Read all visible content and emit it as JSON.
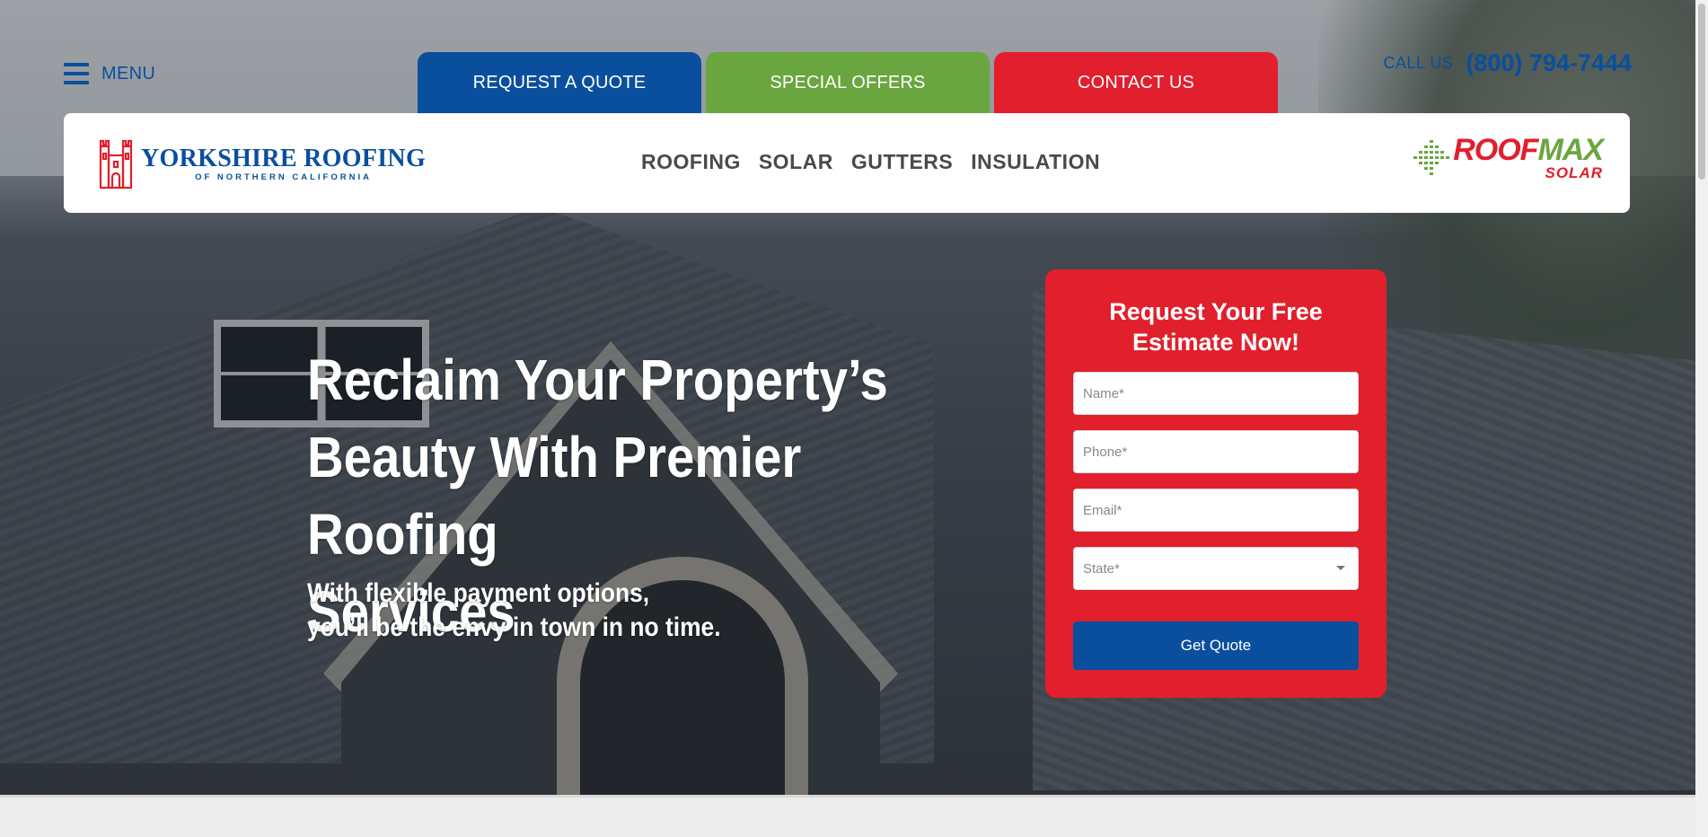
{
  "topbar": {
    "menu_label": "MENU",
    "tabs": [
      {
        "label": "REQUEST A QUOTE"
      },
      {
        "label": "SPECIAL OFFERS"
      },
      {
        "label": "CONTACT US"
      }
    ],
    "call_label": "CALL US",
    "phone": "(800) 794-7444"
  },
  "header": {
    "logo_name": "YORKSHIRE ROOFING",
    "logo_sub": "OF NORTHERN CALIFORNIA",
    "nav": [
      {
        "label": "ROOFING"
      },
      {
        "label": "SOLAR"
      },
      {
        "label": "GUTTERS"
      },
      {
        "label": "INSULATION"
      }
    ],
    "partner_brand_a": "ROOF",
    "partner_brand_b": "MAX",
    "partner_sub": "SOLAR"
  },
  "hero": {
    "headline_lines": [
      "Reclaim Your Property’s",
      "Beauty With Premier Roofing",
      "Services"
    ],
    "sub_lines": [
      "With flexible payment options,",
      "you’ll be the envy in town in no time."
    ]
  },
  "form": {
    "title_lines": [
      "Request Your Free",
      "Estimate Now!"
    ],
    "name_placeholder": "Name*",
    "phone_placeholder": "Phone*",
    "email_placeholder": "Email*",
    "state_placeholder": "State*",
    "submit_label": "Get Quote"
  },
  "colors": {
    "brand_blue": "#0a4f9e",
    "offers_green": "#6aa63f",
    "contact_red": "#e21f2c"
  }
}
